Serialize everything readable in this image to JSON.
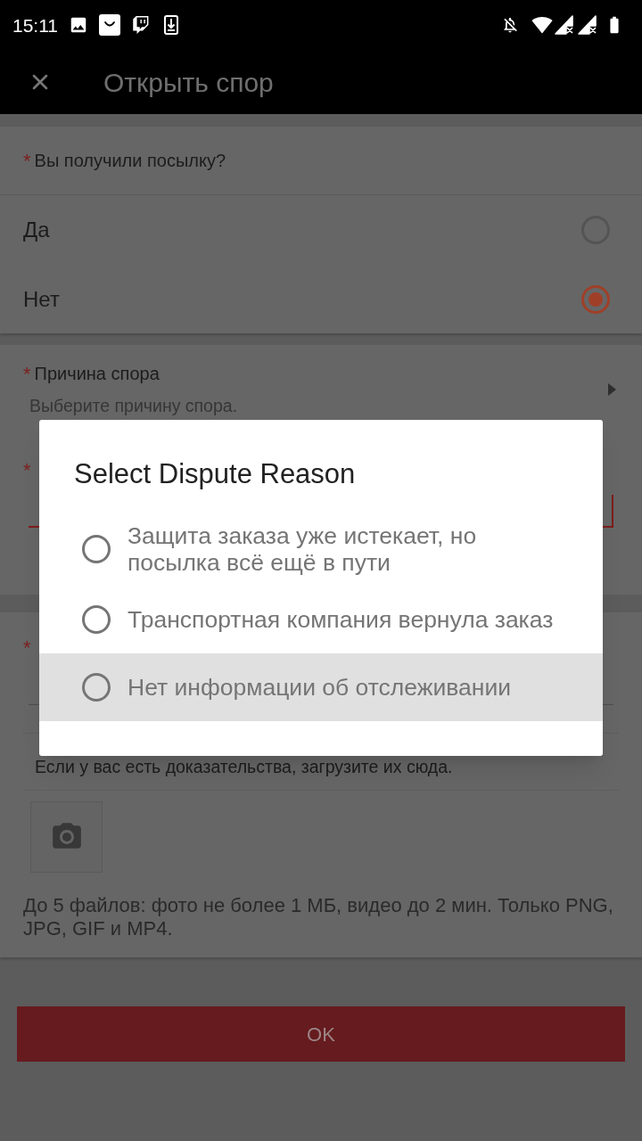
{
  "status_bar": {
    "time": "15:11"
  },
  "app_bar": {
    "title": "Открыть спор"
  },
  "received_question": {
    "required_mark": "*",
    "label": "Вы получили посылку?",
    "options": [
      {
        "label": "Да",
        "selected": false
      },
      {
        "label": "Нет",
        "selected": true
      }
    ]
  },
  "dispute_reason": {
    "required_mark": "*",
    "label": "Причина спора",
    "placeholder": "Выберите причину спора."
  },
  "field_2": {
    "required_mark": "*",
    "error": true
  },
  "field_3": {
    "required_mark": "*",
    "error": false
  },
  "evidence": {
    "hint": "Если у вас есть доказательства, загрузите их сюда.",
    "note": "До 5 файлов: фото не более 1 МБ, видео до 2 мин. Только PNG, JPG, GIF и MP4."
  },
  "ok_button": {
    "label": "OK"
  },
  "dialog": {
    "title": "Select Dispute Reason",
    "options": [
      {
        "label": "Защита заказа уже истекает, но посылка всё ещё в пути",
        "selected": false,
        "highlighted": false
      },
      {
        "label": "Транспортная компания вернула заказ",
        "selected": false,
        "highlighted": false
      },
      {
        "label": "Нет информации об отслеживании",
        "selected": false,
        "highlighted": true
      }
    ]
  }
}
